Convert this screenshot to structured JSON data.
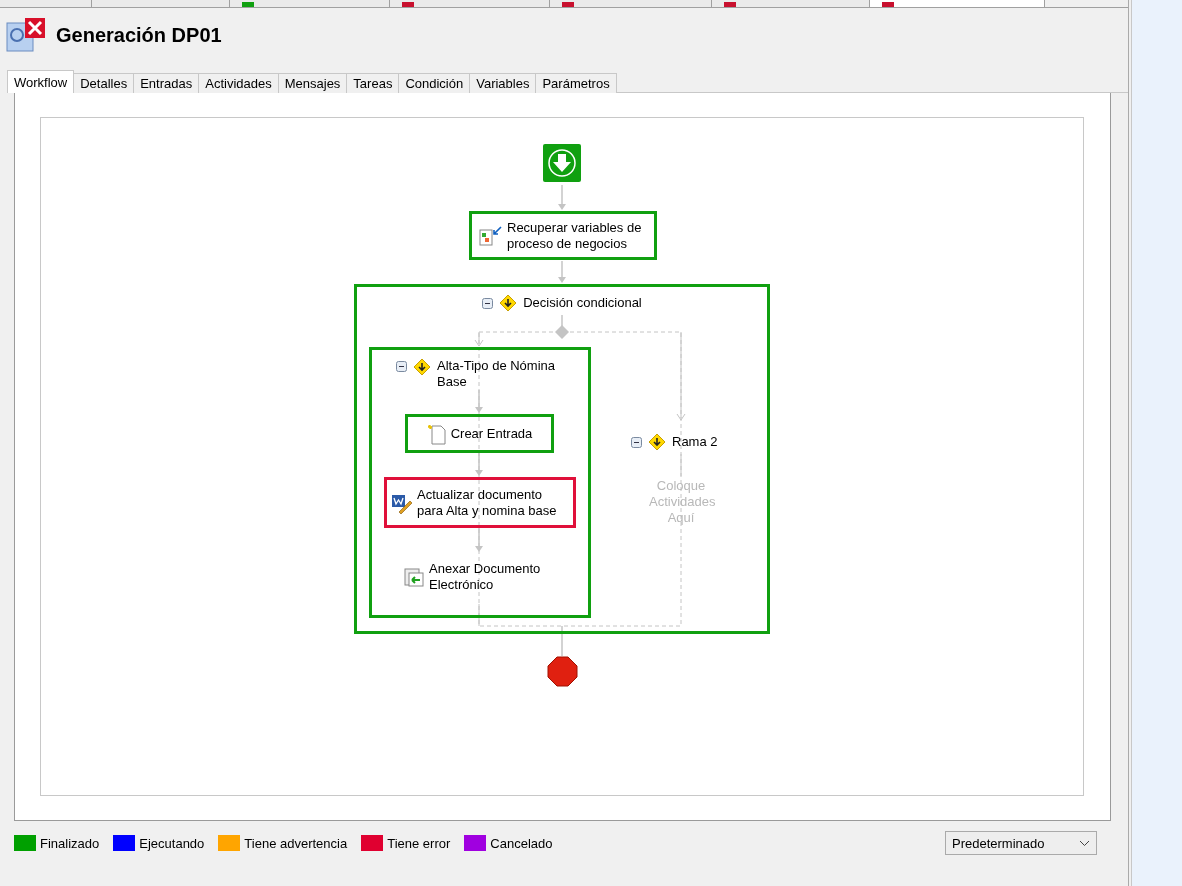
{
  "document_tabs": [
    {
      "selected": false
    },
    {
      "selected": false
    },
    {
      "selected": false,
      "color": "#10a010"
    },
    {
      "selected": false,
      "color": "#c8102e"
    },
    {
      "selected": false,
      "color": "#c8102e"
    },
    {
      "selected": false,
      "color": "#c8102e"
    },
    {
      "selected": true,
      "color": "#c8102e"
    }
  ],
  "header": {
    "title": "Generación DP01"
  },
  "tabs": [
    {
      "label": "Workflow",
      "selected": true
    },
    {
      "label": "Detalles",
      "selected": false
    },
    {
      "label": "Entradas",
      "selected": false
    },
    {
      "label": "Actividades",
      "selected": false
    },
    {
      "label": "Mensajes",
      "selected": false
    },
    {
      "label": "Tareas",
      "selected": false
    },
    {
      "label": "Condición",
      "selected": false
    },
    {
      "label": "Variables",
      "selected": false
    },
    {
      "label": "Parámetros",
      "selected": false
    }
  ],
  "diagram": {
    "retrieve": {
      "label": "Recuperar variables de proceso de negocios",
      "color": "#10a010"
    },
    "decision": {
      "label": "Decisión condicional",
      "color": "#10a010",
      "expanded": true
    },
    "branch_1": {
      "label": "Alta-Tipo de Nómina Base",
      "color": "#10a010",
      "expanded": true,
      "activities": [
        {
          "label": "Crear Entrada",
          "color": "#10a010",
          "kind": "create"
        },
        {
          "label": "Actualizar documento para Alta y nomina base",
          "color": "#e0103a",
          "kind": "word"
        },
        {
          "label": "Anexar Documento Electrónico",
          "kind": "attach"
        }
      ]
    },
    "branch_2": {
      "label": "Rama 2",
      "expanded": true,
      "placeholder": "Coloque Actividades Aquí"
    }
  },
  "legend": [
    {
      "label": "Finalizado",
      "color": "#00a000"
    },
    {
      "label": "Ejecutando",
      "color": "#0000ff"
    },
    {
      "label": "Tiene advertencia",
      "color": "#ffa500"
    },
    {
      "label": "Tiene error",
      "color": "#e00030"
    },
    {
      "label": "Cancelado",
      "color": "#a000e0"
    }
  ],
  "view_select": {
    "value": "Predeterminado"
  }
}
